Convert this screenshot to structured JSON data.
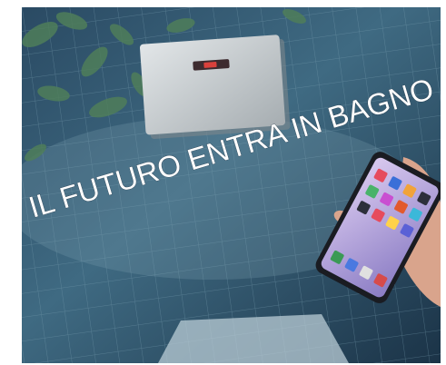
{
  "headline": "IL FUTURO ENTRA IN BAGNO",
  "colors": {
    "floor_dark": "#1f3b52",
    "floor_mid": "#3c627a",
    "tile_line": "#6f94a6",
    "plate": "#c9ced1",
    "plate_shadow": "#8e969b",
    "led": "#d9413c",
    "leaves": "#4f7e5a",
    "phone_screen": "#b7a3d9",
    "hand": "#d9a48c",
    "text": "#ffffff"
  },
  "icons": [
    "flush-plate-icon",
    "smartphone-icon",
    "app-grid-icon"
  ]
}
